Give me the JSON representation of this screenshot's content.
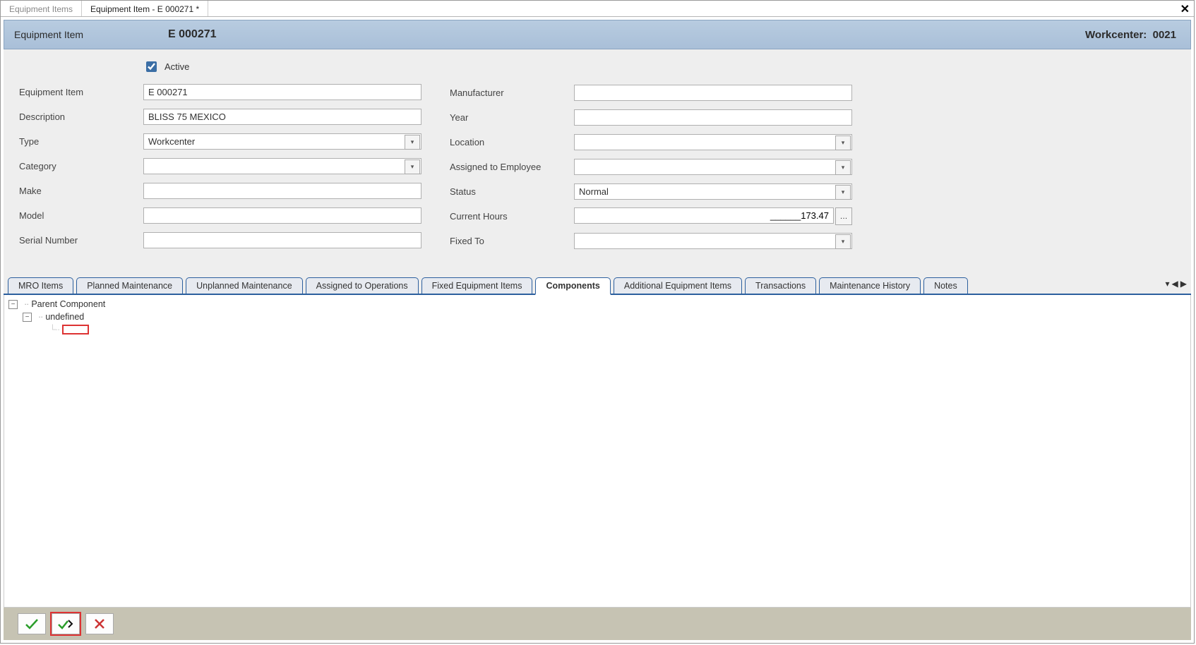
{
  "doc_tabs": {
    "tab1": "Equipment Items",
    "tab2": "Equipment Item - E 000271 *"
  },
  "header": {
    "label": "Equipment Item",
    "id": "E 000271",
    "workcenter_label": "Workcenter:",
    "workcenter_value": "0021"
  },
  "form": {
    "active_label": "Active",
    "left": {
      "equipment_item_label": "Equipment Item",
      "equipment_item_value": "E 000271",
      "description_label": "Description",
      "description_value": "BLISS 75 MEXICO",
      "type_label": "Type",
      "type_value": "Workcenter",
      "category_label": "Category",
      "category_value": "",
      "make_label": "Make",
      "make_value": "",
      "model_label": "Model",
      "model_value": "",
      "serial_label": "Serial Number",
      "serial_value": ""
    },
    "right": {
      "manufacturer_label": "Manufacturer",
      "manufacturer_value": "",
      "year_label": "Year",
      "year_value": "",
      "location_label": "Location",
      "location_value": "",
      "assigned_label": "Assigned to Employee",
      "assigned_value": "",
      "status_label": "Status",
      "status_value": "Normal",
      "hours_label": "Current Hours",
      "hours_value": "______173.47",
      "fixed_to_label": "Fixed To",
      "fixed_to_value": ""
    }
  },
  "tabs": {
    "mro": "MRO Items",
    "planned": "Planned Maintenance",
    "unplanned": "Unplanned Maintenance",
    "ops": "Assigned to Operations",
    "fixed": "Fixed Equipment Items",
    "components": "Components",
    "additional": "Additional Equipment Items",
    "transactions": "Transactions",
    "history": "Maintenance History",
    "notes": "Notes"
  },
  "tree": {
    "root": "Parent Component",
    "child": "undefined"
  }
}
